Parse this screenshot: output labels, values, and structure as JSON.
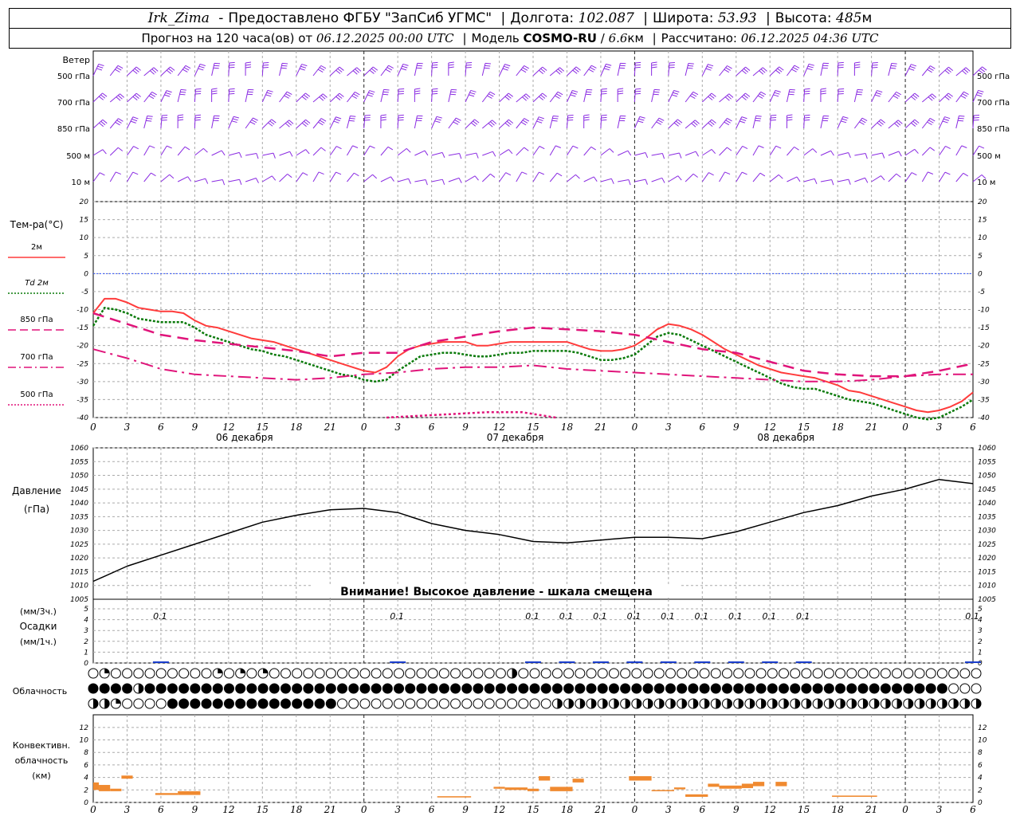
{
  "header": {
    "station": "Irk_Zima",
    "provider": "Предоставлено ФГБУ \"ЗапСиб УГМС\"",
    "lon_label": "Долгота:",
    "lon_value": "102.087",
    "lat_label": "Широта:",
    "lat_value": "53.93",
    "alt_label": "Высота:",
    "alt_value": "485",
    "alt_unit": "м",
    "forecast_label": "Прогноз на 120 часа(ов) от",
    "forecast_start": "06.12.2025 00:00 UTC",
    "model_label": "Модель",
    "model_name": "COSMO-RU",
    "model_res": "6.6",
    "model_res_unit": "км",
    "calc_label": "Рассчитано:",
    "calc_value": "06.12.2025 04:36 UTC"
  },
  "colors": {
    "t2m": "#ff3b3b",
    "td2m": "#0a7a0a",
    "t850": "#e0147a",
    "t700": "#e0147a",
    "t500": "#e0147a",
    "wind": "#8a2be2",
    "zero_line": "#3355ff",
    "precip": "#1a3dcc",
    "conv": "#f08a30",
    "pressure": "#000000",
    "grid": "#aaaaaa"
  },
  "time_axis": {
    "ticks": [
      "0",
      "3",
      "6",
      "9",
      "12",
      "15",
      "18",
      "21",
      "0",
      "3",
      "6",
      "9",
      "12",
      "15",
      "18",
      "21",
      "0",
      "3",
      "6",
      "9",
      "12",
      "15",
      "18",
      "21",
      "0",
      "3",
      "6"
    ],
    "days": [
      "06 декабря",
      "07 декабря",
      "08 декабря"
    ]
  },
  "wind": {
    "label": "Ветер",
    "levels": [
      "500 гПа",
      "700 гПа",
      "850 гПа",
      "500 м",
      "10  м"
    ]
  },
  "temperature": {
    "ylabel": "Тем-ра(°С)",
    "ticks": [
      "20",
      "15",
      "10",
      "5",
      "0",
      "-5",
      "-10",
      "-15",
      "-20",
      "-25",
      "-30",
      "-35",
      "-40"
    ],
    "legend": [
      {
        "name": "2м",
        "style": "solid",
        "color": "#ff3b3b"
      },
      {
        "name": "Td  2м",
        "style": "dotted",
        "color": "#0a7a0a"
      },
      {
        "name": "850 гПа",
        "style": "longdash",
        "color": "#e0147a"
      },
      {
        "name": "700 гПа",
        "style": "dashdot",
        "color": "#e0147a"
      },
      {
        "name": "500 гПа",
        "style": "dotted",
        "color": "#e0147a"
      }
    ]
  },
  "pressure_panel": {
    "ylabel_1": "Давление",
    "ylabel_2": "(гПа)",
    "ticks": [
      "1060",
      "1055",
      "1050",
      "1045",
      "1040",
      "1035",
      "1030",
      "1025",
      "1020",
      "1015",
      "1010",
      "1005"
    ],
    "warning": "Внимание! Высокое давление - шкала смещена"
  },
  "precip_panel": {
    "label_1": "(мм/3ч.)",
    "label_2": "Осадки",
    "label_3": "(мм/1ч.)",
    "ticks": [
      "5",
      "4",
      "3",
      "2",
      "1",
      "0"
    ],
    "amounts": [
      {
        "h": 6,
        "text": "0.1"
      },
      {
        "h": 27,
        "text": "0.1"
      },
      {
        "h": 39,
        "text": "0.1"
      },
      {
        "h": 42,
        "text": "0.1"
      },
      {
        "h": 45,
        "text": "0.1"
      },
      {
        "h": 48,
        "text": "0.1"
      },
      {
        "h": 51,
        "text": "0.1"
      },
      {
        "h": 54,
        "text": "0.1"
      },
      {
        "h": 57,
        "text": "0.1"
      },
      {
        "h": 60,
        "text": "0.1"
      },
      {
        "h": 63,
        "text": "0.1"
      },
      {
        "h": 78,
        "text": "0.1"
      }
    ]
  },
  "cloud_panel": {
    "label": "Облачность"
  },
  "conv_panel": {
    "label_1": "Конвективн.",
    "label_2": "облачность",
    "label_3": "(км)",
    "ticks": [
      "12",
      "10",
      "8",
      "6",
      "4",
      "2",
      "0"
    ]
  },
  "chart_data": {
    "type": "line",
    "x_hours_start": 0,
    "x_hours_end": 78,
    "temp_ylim": [
      -40,
      20
    ],
    "pressure_ylim": [
      1005,
      1060
    ],
    "series": [
      {
        "name": "2м",
        "x": [
          0,
          1,
          2,
          3,
          4,
          5,
          6,
          7,
          8,
          9,
          10,
          11,
          12,
          13,
          14,
          15,
          16,
          17,
          18,
          19,
          20,
          21,
          22,
          23,
          24,
          25,
          26,
          27,
          28,
          29,
          30,
          31,
          32,
          33,
          34,
          35,
          36,
          37,
          38,
          39,
          40,
          41,
          42,
          43,
          44,
          45,
          46,
          47,
          48,
          49,
          50,
          51,
          52,
          53,
          54,
          55,
          56,
          57,
          58,
          59,
          60,
          61,
          62,
          63,
          64,
          65,
          66,
          67,
          68,
          69,
          70,
          71,
          72,
          73,
          74,
          75,
          76,
          77,
          78
        ],
        "values": [
          -11,
          -7,
          -7,
          -8,
          -9.5,
          -10,
          -10.5,
          -10.5,
          -11,
          -13,
          -14.5,
          -15,
          -16,
          -17,
          -18,
          -18.5,
          -19,
          -20,
          -21,
          -22,
          -23,
          -24,
          -25,
          -26,
          -27,
          -27.5,
          -26,
          -23,
          -21,
          -20,
          -19.5,
          -19,
          -19,
          -19,
          -20,
          -20,
          -19.5,
          -19,
          -19,
          -19,
          -19,
          -19,
          -19,
          -20,
          -21,
          -21.5,
          -21.5,
          -21,
          -20,
          -18,
          -15.5,
          -14,
          -14.5,
          -15.5,
          -17,
          -19,
          -21,
          -22.5,
          -24,
          -25.5,
          -26.5,
          -27.5,
          -28,
          -28.5,
          -29,
          -30,
          -31,
          -32.5,
          -33,
          -34,
          -35,
          -36,
          -37,
          -38,
          -38.5,
          -38,
          -37,
          -35.5,
          -33
        ]
      },
      {
        "name": "Td  2м",
        "x": [
          0,
          1,
          2,
          3,
          4,
          5,
          6,
          7,
          8,
          9,
          10,
          11,
          12,
          13,
          14,
          15,
          16,
          17,
          18,
          19,
          20,
          21,
          22,
          23,
          24,
          25,
          26,
          27,
          28,
          29,
          30,
          31,
          32,
          33,
          34,
          35,
          36,
          37,
          38,
          39,
          40,
          41,
          42,
          43,
          44,
          45,
          46,
          47,
          48,
          49,
          50,
          51,
          52,
          53,
          54,
          55,
          56,
          57,
          58,
          59,
          60,
          61,
          62,
          63,
          64,
          65,
          66,
          67,
          68,
          69,
          70,
          71,
          72,
          73,
          74,
          75,
          76,
          77,
          78
        ],
        "values": [
          -14.5,
          -9.5,
          -10,
          -11,
          -12.5,
          -13,
          -13.5,
          -13.5,
          -13.5,
          -15,
          -17,
          -18,
          -19,
          -20,
          -21,
          -21.5,
          -22.5,
          -23,
          -24,
          -25,
          -26,
          -27,
          -28,
          -28.5,
          -29.5,
          -30,
          -29.5,
          -27,
          -25,
          -23,
          -22.5,
          -22,
          -22,
          -22.5,
          -23,
          -23,
          -22.5,
          -22,
          -22,
          -21.5,
          -21.5,
          -21.5,
          -21.5,
          -22,
          -23,
          -24,
          -24,
          -23.5,
          -22.5,
          -20,
          -17.5,
          -16.5,
          -17,
          -18.5,
          -20,
          -21.5,
          -23,
          -24.5,
          -26,
          -27.5,
          -29,
          -30.5,
          -31.5,
          -32,
          -32,
          -33,
          -34,
          -35,
          -35.5,
          -36,
          -37,
          -38,
          -39,
          -40,
          -40.5,
          -40,
          -38.5,
          -37,
          -35
        ]
      },
      {
        "name": "850 гПа",
        "x": [
          0,
          3,
          6,
          9,
          12,
          15,
          18,
          21,
          24,
          27,
          30,
          33,
          36,
          39,
          42,
          45,
          48,
          51,
          54,
          57,
          60,
          63,
          66,
          69,
          72,
          75,
          78
        ],
        "values": [
          -11,
          -14,
          -17,
          -18.5,
          -19.5,
          -20.5,
          -21.5,
          -23,
          -22,
          -22,
          -19,
          -17.5,
          -16,
          -15,
          -15.5,
          -16,
          -17,
          -19,
          -21,
          -22,
          -24.5,
          -27,
          -28,
          -28.5,
          -28.5,
          -27,
          -25
        ]
      },
      {
        "name": "700 гПа",
        "x": [
          0,
          3,
          6,
          9,
          12,
          15,
          18,
          21,
          24,
          27,
          30,
          33,
          36,
          39,
          42,
          45,
          48,
          51,
          54,
          57,
          60,
          63,
          66,
          69,
          72,
          75,
          78
        ],
        "values": [
          -21,
          -23.5,
          -26.5,
          -28,
          -28.5,
          -29,
          -29.5,
          -29,
          -28,
          -27.5,
          -26.5,
          -26,
          -26,
          -25.5,
          -26.5,
          -27,
          -27.5,
          -28,
          -28.5,
          -29,
          -29.5,
          -30,
          -30,
          -29.5,
          -28.5,
          -28,
          -28
        ]
      },
      {
        "name": "500 гПа",
        "x": [
          26,
          29,
          32,
          35,
          38,
          41
        ],
        "values": [
          -40,
          -39.5,
          -39,
          -38.5,
          -38.5,
          -40
        ]
      },
      {
        "name": "Давление",
        "x": [
          0,
          3,
          6,
          9,
          12,
          15,
          18,
          21,
          24,
          27,
          30,
          33,
          36,
          39,
          42,
          45,
          48,
          51,
          54,
          57,
          60,
          63,
          66,
          69,
          72,
          75,
          78
        ],
        "values": [
          1011.5,
          1017,
          1021,
          1025,
          1029,
          1033,
          1035.5,
          1037.5,
          1038,
          1036.5,
          1032.5,
          1030,
          1028.5,
          1026,
          1025.5,
          1026.5,
          1027.5,
          1027.5,
          1027,
          1029.5,
          1033,
          1036.5,
          1039,
          1042.5,
          1045,
          1048.5,
          1047
        ]
      }
    ],
    "precip_mm": [
      {
        "x": 6,
        "value": 0.1
      },
      {
        "x": 27,
        "value": 0.1
      },
      {
        "x": 39,
        "value": 0.1
      },
      {
        "x": 42,
        "value": 0.1
      },
      {
        "x": 45,
        "value": 0.1
      },
      {
        "x": 48,
        "value": 0.1
      },
      {
        "x": 51,
        "value": 0.1
      },
      {
        "x": 54,
        "value": 0.1
      },
      {
        "x": 57,
        "value": 0.1
      },
      {
        "x": 60,
        "value": 0.1
      },
      {
        "x": 63,
        "value": 0.1
      },
      {
        "x": 78,
        "value": 0.1
      }
    ],
    "convective_cloud_km": [
      {
        "x0": 0,
        "x1": 0.5,
        "base": 2.0,
        "top": 3.2
      },
      {
        "x0": 0.5,
        "x1": 1.5,
        "base": 1.8,
        "top": 2.8
      },
      {
        "x0": 1.5,
        "x1": 2.5,
        "base": 1.8,
        "top": 2.2
      },
      {
        "x0": 2.5,
        "x1": 3.5,
        "base": 3.8,
        "top": 4.3
      },
      {
        "x0": 5.5,
        "x1": 7.5,
        "base": 1.2,
        "top": 1.5
      },
      {
        "x0": 7.5,
        "x1": 9.5,
        "base": 1.2,
        "top": 1.8
      },
      {
        "x0": 30.5,
        "x1": 33.5,
        "base": 0.8,
        "top": 1.0
      },
      {
        "x0": 35.5,
        "x1": 36.5,
        "base": 2.2,
        "top": 2.5
      },
      {
        "x0": 36.5,
        "x1": 38.5,
        "base": 2.0,
        "top": 2.4
      },
      {
        "x0": 38.5,
        "x1": 39.5,
        "base": 1.8,
        "top": 2.2
      },
      {
        "x0": 39.5,
        "x1": 40.5,
        "base": 3.5,
        "top": 4.2
      },
      {
        "x0": 40.5,
        "x1": 42.5,
        "base": 1.8,
        "top": 2.5
      },
      {
        "x0": 42.5,
        "x1": 43.5,
        "base": 3.2,
        "top": 3.8
      },
      {
        "x0": 47.5,
        "x1": 49.5,
        "base": 3.5,
        "top": 4.2
      },
      {
        "x0": 49.5,
        "x1": 51.5,
        "base": 1.8,
        "top": 2.0
      },
      {
        "x0": 51.5,
        "x1": 52.5,
        "base": 2.1,
        "top": 2.4
      },
      {
        "x0": 52.5,
        "x1": 54.5,
        "base": 0.9,
        "top": 1.3
      },
      {
        "x0": 54.5,
        "x1": 55.5,
        "base": 2.5,
        "top": 3.0
      },
      {
        "x0": 55.5,
        "x1": 57.5,
        "base": 2.2,
        "top": 2.7
      },
      {
        "x0": 57.5,
        "x1": 58.5,
        "base": 2.3,
        "top": 3.0
      },
      {
        "x0": 58.5,
        "x1": 59.5,
        "base": 2.6,
        "top": 3.3
      },
      {
        "x0": 60.5,
        "x1": 61.5,
        "base": 2.6,
        "top": 3.3
      },
      {
        "x0": 65.5,
        "x1": 69.5,
        "base": 0.9,
        "top": 1.1
      }
    ],
    "cloud_rows": [
      "ocooooooooocococooooooooooooooooooooohoooooooooooooooooooooooooooooooooooooooooo",
      "ffffhfffffffffffffffffffffffffffffffffffffffffffffffffffffffffffffffffffffffoooooo",
      "hhcoooofffffffffffffffooooooooooooooooooohhhhhhhhhhhhhhhhhhhhhhhhhhhhhhhhhhhhhh"
    ]
  }
}
